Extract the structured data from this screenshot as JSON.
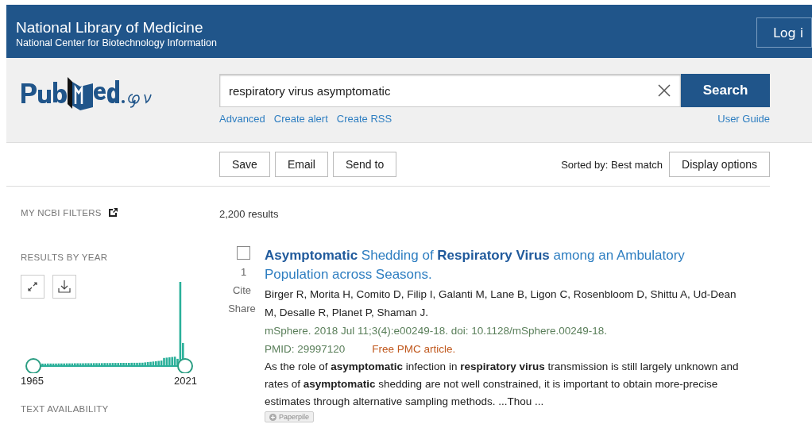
{
  "header": {
    "title": "National Library of Medicine",
    "subtitle": "National Center for Biotechnology Information",
    "login_button": "Log i"
  },
  "search": {
    "value": "respiratory virus asymptomatic",
    "button": "Search",
    "links": [
      "Advanced",
      "Create alert",
      "Create RSS"
    ],
    "user_guide": "User Guide"
  },
  "toolbar": {
    "buttons": [
      "Save",
      "Email",
      "Send to"
    ],
    "sort_label": "Sorted by: Best match",
    "display_button": "Display options"
  },
  "sidebar": {
    "filters_heading": "MY NCBI FILTERS",
    "year_heading": "RESULTS BY YEAR",
    "year_start": "1965",
    "year_end": "2021",
    "text_heading": "TEXT AVAILABILITY"
  },
  "results_count": "2,200 results",
  "results": [
    {
      "checked": false,
      "number": "1",
      "cite": "Cite",
      "share": "Share",
      "title": "**Asymptomatic** Shedding of **Respiratory Virus** among an Ambulatory Population across Seasons.",
      "authors": "Birger R, Morita H, Comito D, Filip I, Galanti M, Lane B, Ligon C, Rosenbloom D, Shittu A, Ud-Dean M, Desalle R, Planet P, Shaman J.",
      "citation": "mSphere. 2018 Jul 11;3(4):e00249-18. doi: 10.1128/mSphere.00249-18.",
      "pmid": "PMID: 29997120",
      "free": "Free PMC article.",
      "snippet": "As the role of **asymptomatic** infection in **respiratory virus** transmission is still largely unknown and rates of **asymptomatic** shedding are not well constrained, it is important to obtain more-precise estimates through alternative sampling methods. ...Thou ...",
      "paperpile": "Paperpile"
    }
  ]
}
